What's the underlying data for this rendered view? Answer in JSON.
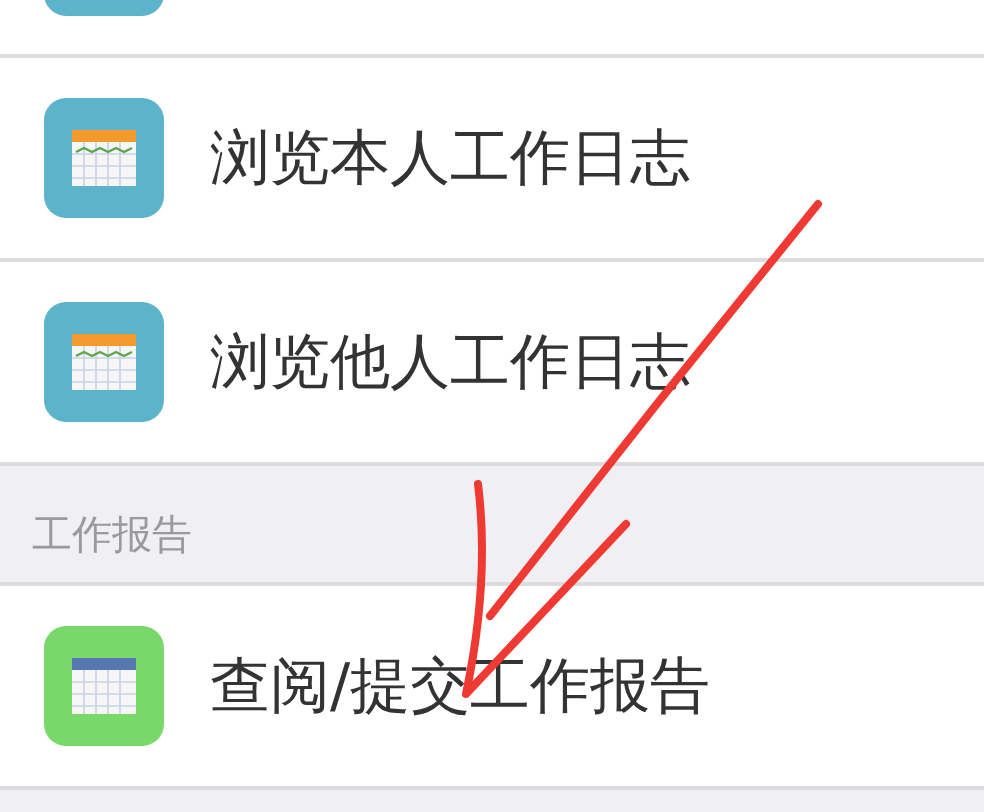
{
  "sections": [
    {
      "items": [
        {
          "label": "浏览本人工作日志",
          "kind": "log"
        },
        {
          "label": "浏览他人工作日志",
          "kind": "log"
        }
      ]
    },
    {
      "header": "工作报告",
      "items": [
        {
          "label": "查阅/提交工作报告",
          "kind": "report"
        }
      ]
    }
  ]
}
